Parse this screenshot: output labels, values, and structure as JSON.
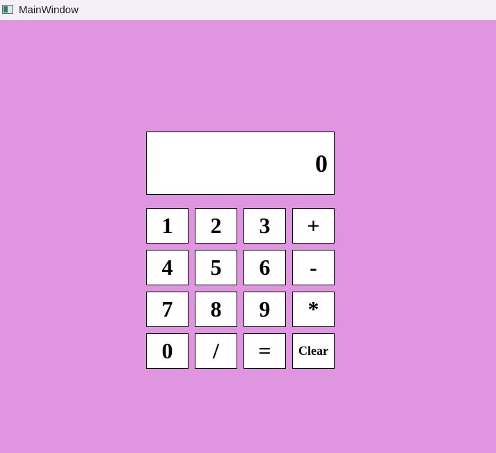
{
  "window": {
    "title": "MainWindow",
    "background": "#DF95DF",
    "icon": "app-window-icon"
  },
  "display": {
    "value": "0"
  },
  "buttons": {
    "one": "1",
    "two": "2",
    "three": "3",
    "plus": "+",
    "four": "4",
    "five": "5",
    "six": "6",
    "minus": "-",
    "seven": "7",
    "eight": "8",
    "nine": "9",
    "multiply": "*",
    "zero": "0",
    "divide": "/",
    "equals": "=",
    "clear": "Clear"
  }
}
